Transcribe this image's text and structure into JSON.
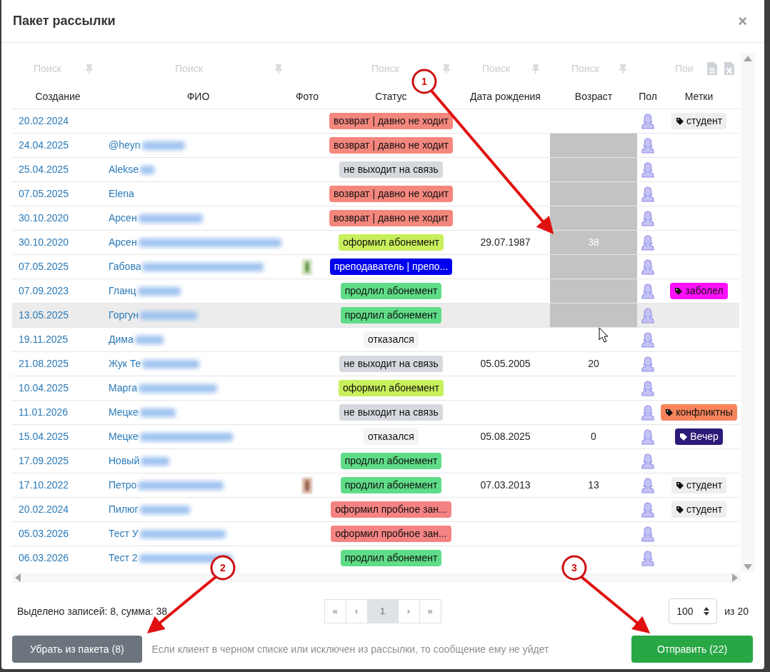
{
  "dialog": {
    "title": "Пакет рассылки",
    "close": "×"
  },
  "table": {
    "columns": [
      {
        "header": "Создание",
        "search_placeholder": "Поиск"
      },
      {
        "header": "ФИО",
        "search_placeholder": "Поиск"
      },
      {
        "header": "Фото"
      },
      {
        "header": "Статус",
        "search_placeholder": "Поиск"
      },
      {
        "header": "Дата рождения",
        "search_placeholder": "Поиск"
      },
      {
        "header": "Возраст",
        "search_placeholder": "Поиск"
      },
      {
        "header": "Пол"
      },
      {
        "header": "Метки",
        "search_placeholder": "Пои"
      }
    ],
    "rows": [
      {
        "created": "20.02.2024",
        "status": {
          "label": "возврат | давно не ходит",
          "color": "#f4877d"
        },
        "age_selected": false,
        "hovered": false,
        "photo": false,
        "tag": {
          "label": "студент",
          "color": "#eeeeee"
        }
      },
      {
        "created": "24.04.2025",
        "name": "@heyn",
        "status": {
          "label": "возврат | давно не ходит",
          "color": "#f4877d"
        },
        "age_selected": true,
        "hovered": false,
        "photo": false
      },
      {
        "created": "25.04.2025",
        "name": "Alekse",
        "status": {
          "label": "не выходит на связь",
          "color": "#d6d9dd"
        },
        "age_selected": true,
        "hovered": false,
        "photo": false
      },
      {
        "created": "07.05.2025",
        "name": "Elena",
        "status": {
          "label": "возврат | давно не ходит",
          "color": "#f4877d"
        },
        "age_selected": true,
        "hovered": false,
        "photo": false
      },
      {
        "created": "30.10.2020",
        "name": "Арсен",
        "status": {
          "label": "возврат | давно не ходит",
          "color": "#f4877d"
        },
        "age_selected": true,
        "hovered": false,
        "photo": false
      },
      {
        "created": "30.10.2020",
        "name": "Арсен",
        "status": {
          "label": "оформил абонемент",
          "color": "#c8ef5c"
        },
        "birth_date": "29.07.1987",
        "age": "38",
        "age_selected": true,
        "hovered": false,
        "photo": false
      },
      {
        "created": "07.05.2025",
        "name": "Габова",
        "status": {
          "label": "преподаватель | препо...",
          "color": "#0000ee"
        },
        "age_selected": true,
        "hovered": false,
        "photo": true
      },
      {
        "created": "07.09.2023",
        "name": "Гланц",
        "status": {
          "label": "продлил абонемент",
          "color": "#5fdc87"
        },
        "age_selected": true,
        "hovered": false,
        "photo": false,
        "tag": {
          "label": "заболел",
          "color": "#ff11ff"
        }
      },
      {
        "created": "13.05.2025",
        "name": "Горгун",
        "status": {
          "label": "продлил абонемент",
          "color": "#5fdc87"
        },
        "age_selected": true,
        "hovered": true,
        "photo": false
      },
      {
        "created": "19.11.2025",
        "name": "Дима",
        "status": {
          "label": "отказался",
          "color": "#f2f4f6"
        },
        "age_selected": false,
        "hovered": false,
        "photo": false
      },
      {
        "created": "21.08.2025",
        "name": "Жук Те",
        "status": {
          "label": "не выходит на связь",
          "color": "#d6d9dd"
        },
        "birth_date": "05.05.2005",
        "age": "20",
        "age_selected": false,
        "hovered": false,
        "photo": false
      },
      {
        "created": "10.04.2025",
        "name": "Марга",
        "status": {
          "label": "оформил абонемент",
          "color": "#c8ef5c"
        },
        "age_selected": false,
        "hovered": false,
        "photo": false
      },
      {
        "created": "11.01.2026",
        "name": "Мецке",
        "status": {
          "label": "не выходит на связь",
          "color": "#d6d9dd"
        },
        "age_selected": false,
        "hovered": false,
        "photo": false,
        "tag": {
          "label": "конфликтны",
          "color": "#f7845b"
        }
      },
      {
        "created": "15.04.2025",
        "name": "Мецке",
        "status": {
          "label": "отказался",
          "color": "#f2f4f6"
        },
        "birth_date": "05.08.2025",
        "age": "0",
        "age_selected": false,
        "hovered": false,
        "photo": false,
        "tag": {
          "label": "Вечер",
          "color": "#2d1a78"
        }
      },
      {
        "created": "17.09.2025",
        "name": "Новый",
        "status": {
          "label": "продлил абонемент",
          "color": "#5fdc87"
        },
        "age_selected": false,
        "hovered": false,
        "photo": false
      },
      {
        "created": "17.10.2022",
        "name": "Петро",
        "status": {
          "label": "продлил абонемент",
          "color": "#5fdc87"
        },
        "birth_date": "07.03.2013",
        "age": "13",
        "age_selected": false,
        "hovered": false,
        "photo": true,
        "tag": {
          "label": "студент",
          "color": "#eeeeee"
        }
      },
      {
        "created": "20.02.2024",
        "name": "Пилюг",
        "status": {
          "label": "оформил пробное зан...",
          "color": "#f58383"
        },
        "age_selected": false,
        "hovered": false,
        "photo": false,
        "tag": {
          "label": "студент",
          "color": "#eeeeee"
        }
      },
      {
        "created": "05.03.2026",
        "name": "Тест У",
        "status": {
          "label": "оформил пробное зан...",
          "color": "#f58383"
        },
        "age_selected": false,
        "hovered": false,
        "photo": false
      },
      {
        "created": "06.03.2026",
        "name": "Тест 2",
        "status": {
          "label": "продлил абонемент",
          "color": "#5fdc87"
        },
        "age_selected": false,
        "hovered": false,
        "photo": false
      }
    ]
  },
  "summary": "Выделено записей: 8, сумма: 38",
  "pagination": [
    {
      "label": "«",
      "selected": false
    },
    {
      "label": "‹",
      "selected": false
    },
    {
      "label": "1",
      "selected": true
    },
    {
      "label": "›",
      "selected": false
    },
    {
      "label": "»",
      "selected": false
    }
  ],
  "page_size": "100",
  "total": "из 20",
  "remove_button": "Убрать из пакета (8)",
  "note": "Если клиент в черном списке или исключен из рассылки, то сообщение ему не уйдет",
  "send_button": "Отправить (22)",
  "annotations": [
    "1",
    "2",
    "3"
  ]
}
